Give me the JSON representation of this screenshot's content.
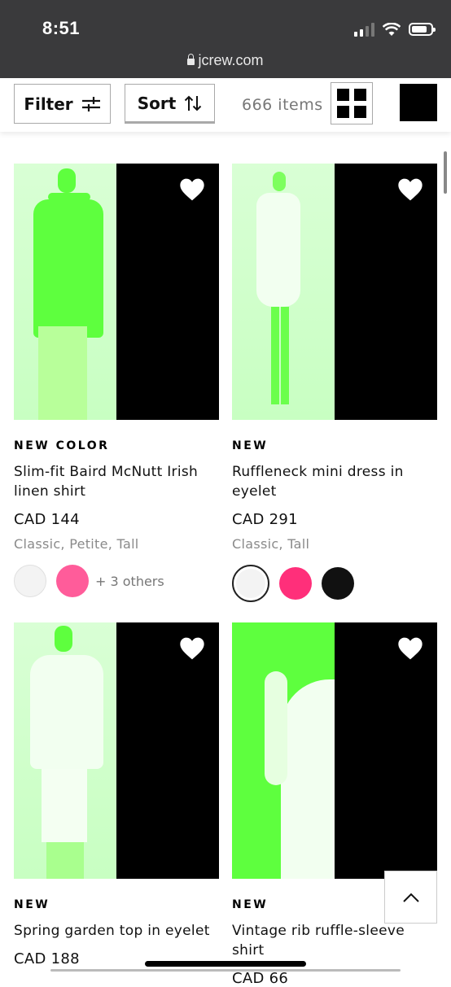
{
  "status_bar": {
    "time": "8:51"
  },
  "browser": {
    "url": "jcrew.com"
  },
  "toolbar": {
    "filter_label": "Filter",
    "sort_label": "Sort",
    "items_count": "666 items"
  },
  "products": [
    {
      "tag": "NEW COLOR",
      "name": "Slim-fit Baird McNutt Irish linen shirt",
      "price": "CAD 144",
      "fits": "Classic, Petite, Tall",
      "swatches": [
        "#f3f3f3",
        "#ff5c9a"
      ],
      "more_colors": "+ 3 others"
    },
    {
      "tag": "NEW",
      "name": "Ruffleneck mini dress in eyelet",
      "price": "CAD 291",
      "fits": "Classic, Tall",
      "swatches": [
        "#f3f3f3",
        "#ff2f7a",
        "#111111"
      ]
    },
    {
      "tag": "NEW",
      "name": "Spring garden top in eyelet",
      "price": "CAD 188"
    },
    {
      "tag": "NEW",
      "name": "Vintage rib ruffle-sleeve shirt",
      "price": "CAD 66"
    }
  ],
  "icons": {
    "filter": "sliders-icon",
    "sort": "sort-arrows-icon",
    "wishlist": "heart-icon",
    "back_to_top": "chevron-up-icon"
  },
  "colors": {
    "image_tint": "#5eff3e",
    "accent": "#000000"
  }
}
